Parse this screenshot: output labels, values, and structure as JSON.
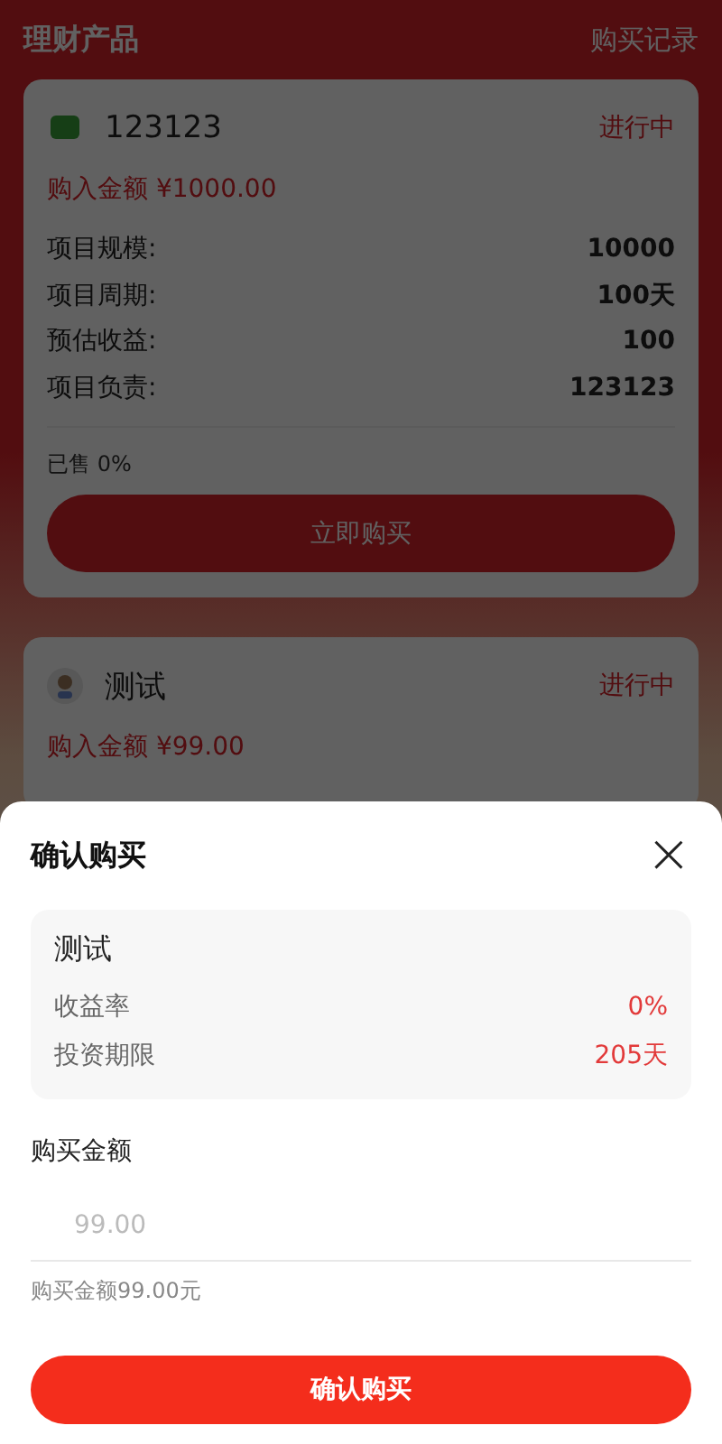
{
  "header": {
    "title": "理财产品",
    "link": "购买记录"
  },
  "products": [
    {
      "name": "123123",
      "status": "进行中",
      "amount": "购入金额 ¥1000.00",
      "details": [
        {
          "label": "项目规模:",
          "value": "10000"
        },
        {
          "label": "项目周期:",
          "value": "100天"
        },
        {
          "label": "预估收益:",
          "value": "100"
        },
        {
          "label": "项目负责:",
          "value": "123123"
        }
      ],
      "sold": "已售 0%",
      "button": "立即购买"
    },
    {
      "name": "测试",
      "status": "进行中",
      "amount": "购入金额 ¥99.00"
    }
  ],
  "dialog": {
    "title": "确认购买",
    "close": "×",
    "product": {
      "name": "测试",
      "rows": [
        {
          "label": "收益率",
          "value": "0%"
        },
        {
          "label": "投资期限",
          "value": "205天"
        }
      ]
    },
    "amount_label": "购买金额",
    "amount_field": {
      "placeholder": "99.00"
    },
    "hint": "购买金额99.00元",
    "confirm": "确认购买"
  }
}
